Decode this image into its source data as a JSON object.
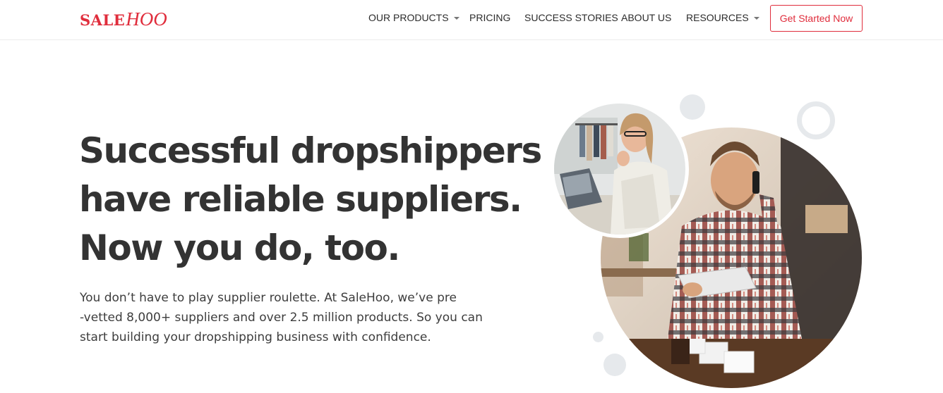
{
  "brand": {
    "logo_text_a": "SALE",
    "logo_text_b": "HOO",
    "color": "#e02d3c"
  },
  "nav": {
    "items": [
      {
        "label": "OUR PRODUCTS",
        "has_dropdown": true
      },
      {
        "label": "PRICING",
        "has_dropdown": false
      },
      {
        "label": "SUCCESS STORIES",
        "has_dropdown": false
      },
      {
        "label": "ABOUT US",
        "has_dropdown": false
      },
      {
        "label": "RESOURCES",
        "has_dropdown": true
      }
    ],
    "cta_label": "Get Started Now"
  },
  "hero": {
    "headline_lines": [
      "Successful dropshippers",
      "have reliable suppliers.",
      "Now you do, too."
    ],
    "subtext_lines": [
      "You don’t have to play supplier roulette. At SaleHoo, we’ve pre",
      "-vetted 8,000+ suppliers and over 2.5 million products. So you can",
      "start building your dropshipping business with confidence."
    ]
  },
  "colors": {
    "accent": "#e02d3c",
    "text": "#333333",
    "decor": "#e6e9ec"
  }
}
